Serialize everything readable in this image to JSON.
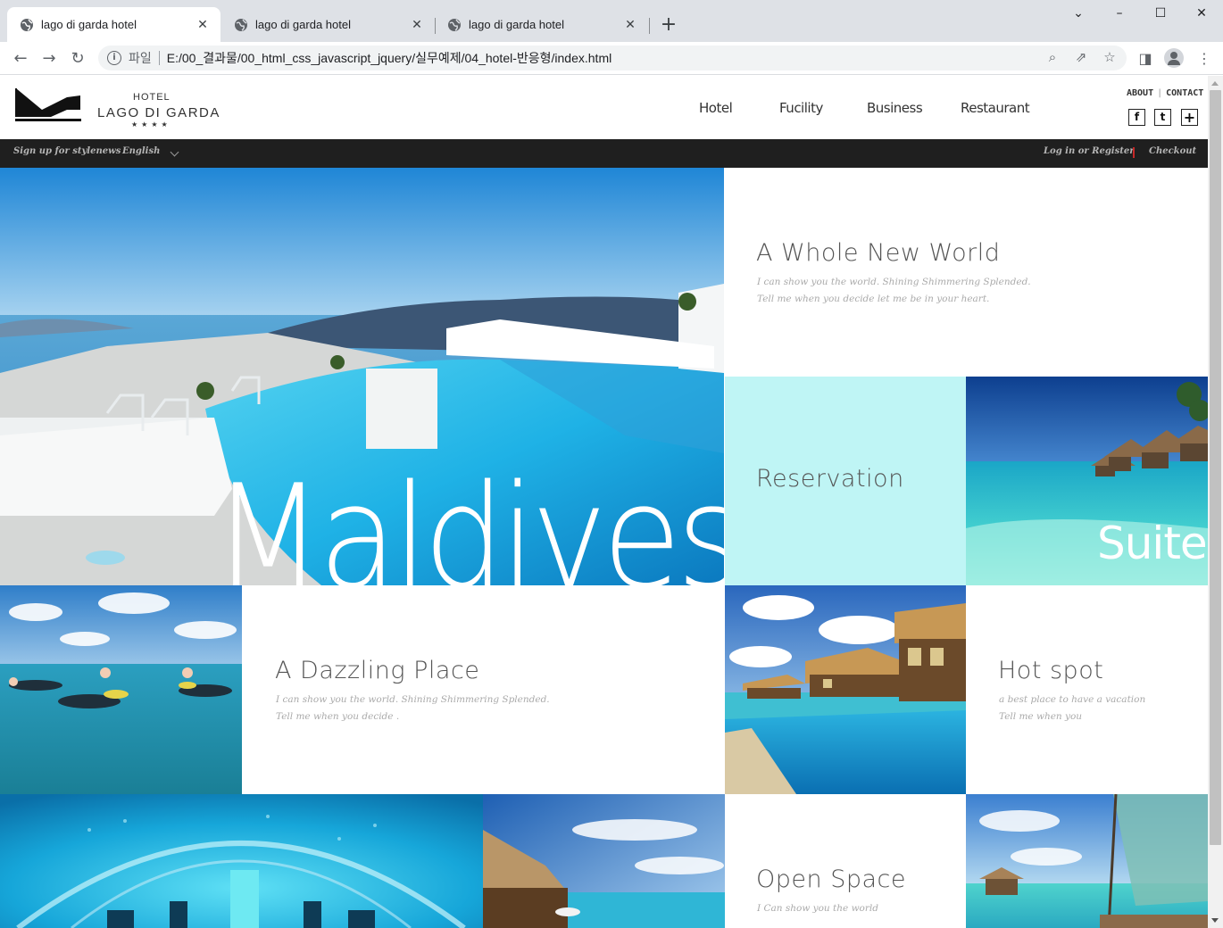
{
  "browser": {
    "tabs": [
      {
        "title": "lago di garda hotel",
        "active": true
      },
      {
        "title": "lago di garda hotel",
        "active": false
      },
      {
        "title": "lago di garda hotel",
        "active": false
      }
    ],
    "address": {
      "scheme_label": "파일",
      "url": "E:/00_결과물/00_html_css_javascript_jquery/실무예제/04_hotel-반응형/index.html"
    },
    "window_controls": {
      "minimize": "–",
      "maximize": "☐",
      "close": "✕"
    }
  },
  "header": {
    "logo": {
      "small": "HOTEL",
      "big": "LAGO DI GARDA",
      "stars": "★★★★"
    },
    "nav": [
      "Hotel",
      "Fucility",
      "Business",
      "Restaurant"
    ],
    "util_links": [
      "ABOUT",
      "CONTACT"
    ],
    "sns": [
      {
        "icon": "facebook-icon",
        "glyph": "f"
      },
      {
        "icon": "twitter-icon",
        "glyph": "t"
      },
      {
        "icon": "plus-icon",
        "glyph": "+"
      }
    ]
  },
  "topbar": {
    "signup": "Sign up for stylenews",
    "language": "English",
    "login": "Log in or Register",
    "checkout": "Checkout"
  },
  "tiles": {
    "hero_word": "Maldives",
    "whole_new_world": {
      "title": "A Whole New World",
      "lines": [
        "I can show you the world. Shining Shimmering Splended.",
        "Tell me when you decide let me be in your heart."
      ]
    },
    "reservation": {
      "title": "Reservation"
    },
    "suite": {
      "title": "Suite"
    },
    "dazzling": {
      "title": "A Dazzling Place",
      "lines": [
        "I can show you the world. Shining Shimmering Splended.",
        "Tell me when you decide ."
      ]
    },
    "hotspot": {
      "title": "Hot spot",
      "lines": [
        "a best place to have a vacation",
        "Tell me when you"
      ]
    },
    "open_space": {
      "title": "Open Space",
      "lines": [
        "I Can show you the world"
      ]
    }
  }
}
